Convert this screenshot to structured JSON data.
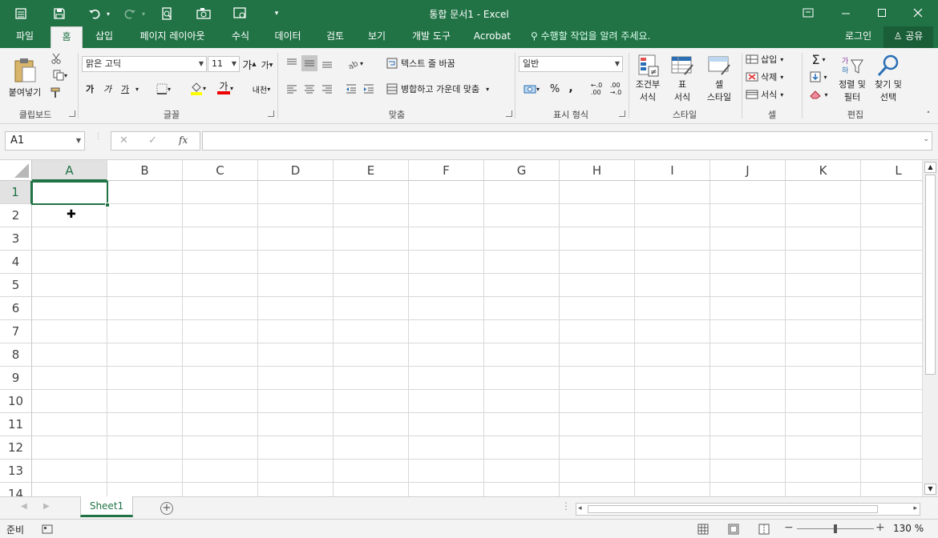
{
  "title_bar": {
    "title": "통합 문서1 - Excel",
    "icons": [
      "autosave-icon",
      "save-icon",
      "undo-icon",
      "redo-icon",
      "print-preview-icon",
      "camera-icon",
      "customize-icon",
      "qat-menu-icon",
      "ribbon-display-icon",
      "minimize-icon",
      "maximize-icon",
      "close-icon"
    ]
  },
  "tabs": {
    "items": [
      "파일",
      "홈",
      "삽입",
      "페이지 레이아웃",
      "수식",
      "데이터",
      "검토",
      "보기",
      "개발 도구",
      "Acrobat"
    ],
    "active": "홈",
    "tell_me": "수행할 작업을 알려 주세요.",
    "login": "로그인",
    "share": "공유"
  },
  "ribbon": {
    "clipboard": {
      "paste": "붙여넣기",
      "label": "클립보드"
    },
    "font": {
      "name": "맑은 고딕",
      "size": "11",
      "bold": "가",
      "italic": "가",
      "underline": "가",
      "font_color": "가",
      "phonetic": "내천",
      "label": "글꼴"
    },
    "alignment": {
      "wrap_text": "텍스트 줄 바꿈",
      "merge_center": "병합하고 가운데 맞춤",
      "label": "맞춤"
    },
    "number": {
      "format": "일반",
      "percent": "%",
      "comma": ",",
      "label": "표시 형식"
    },
    "styles": {
      "conditional_1": "조건부",
      "conditional_2": "서식",
      "table_1": "표",
      "table_2": "서식",
      "cell_1": "셀",
      "cell_2": "스타일",
      "label": "스타일"
    },
    "cells": {
      "insert": "삽입",
      "delete": "삭제",
      "format": "서식",
      "label": "셀"
    },
    "editing": {
      "sort_1": "정렬 및",
      "sort_2": "필터",
      "find_1": "찾기 및",
      "find_2": "선택",
      "label": "편집"
    }
  },
  "formula_bar": {
    "name_box": "A1",
    "fx": "fx",
    "content": ""
  },
  "grid": {
    "columns": [
      "A",
      "B",
      "C",
      "D",
      "E",
      "F",
      "G",
      "H",
      "I",
      "J",
      "K",
      "L"
    ],
    "rows": [
      "1",
      "2",
      "3",
      "4",
      "5",
      "6",
      "7",
      "8",
      "9",
      "10",
      "11",
      "12",
      "13",
      "14"
    ],
    "selected_cell": "A1"
  },
  "sheets": {
    "tabs": [
      "Sheet1"
    ],
    "active": "Sheet1"
  },
  "status": {
    "ready": "준비",
    "zoom": "130 %"
  },
  "colors": {
    "accent": "#217346",
    "ribbon_bg": "#f3f3f3"
  }
}
